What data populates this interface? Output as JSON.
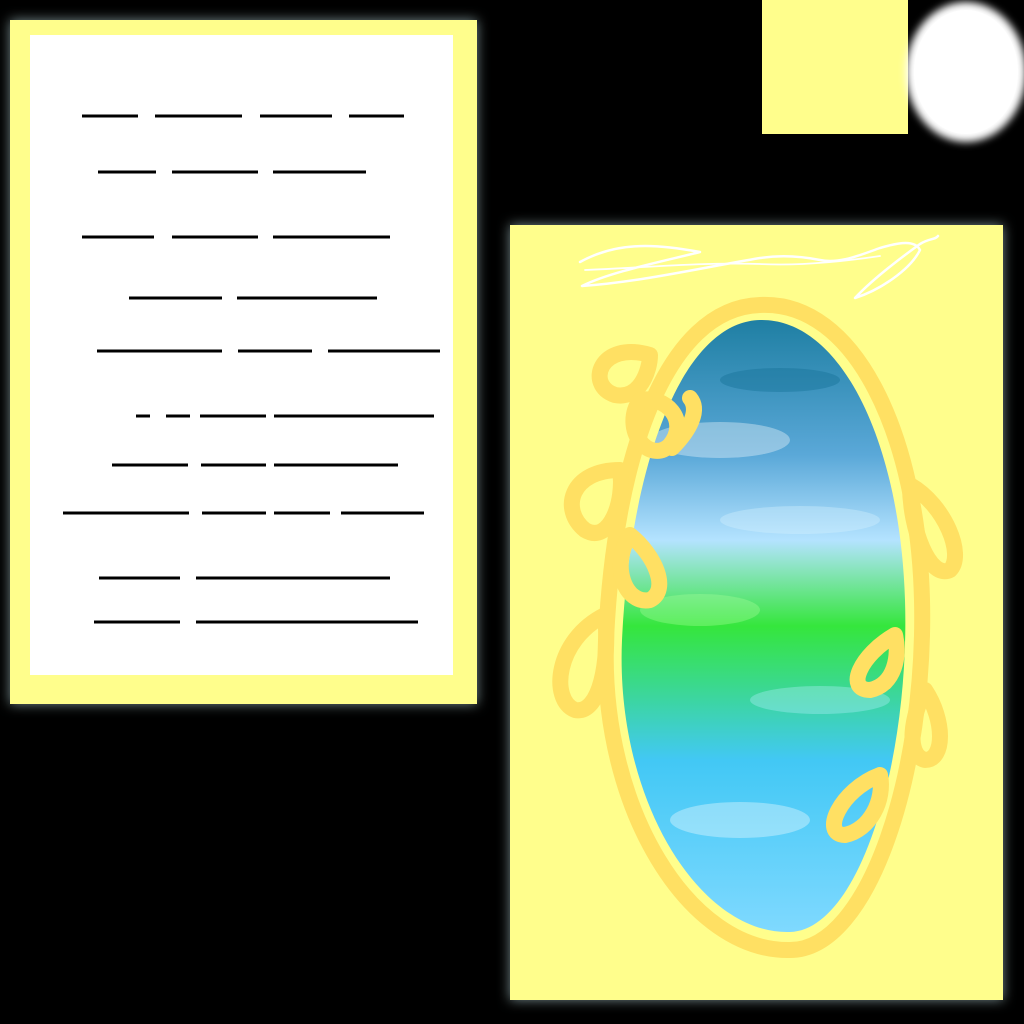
{
  "scene": {
    "background_color": "#000000",
    "card_yellow": "#fffe8c",
    "paper_white": "#ffffff",
    "ink_black": "#000000",
    "frame_gold": "#ffe063",
    "glow_color": "#d6faff",
    "mirror_colors": [
      "#1f7fa3",
      "#5aa8d8",
      "#b4e3ff",
      "#35e63c",
      "#42c8f5",
      "#7fd9ff"
    ]
  },
  "letter_card": {
    "text_lines": 10,
    "signature_handwritten": true
  },
  "mirror_card": {
    "ornament_loops": 10
  },
  "decorations": [
    "small-yellow-note",
    "white-moon-circle"
  ]
}
